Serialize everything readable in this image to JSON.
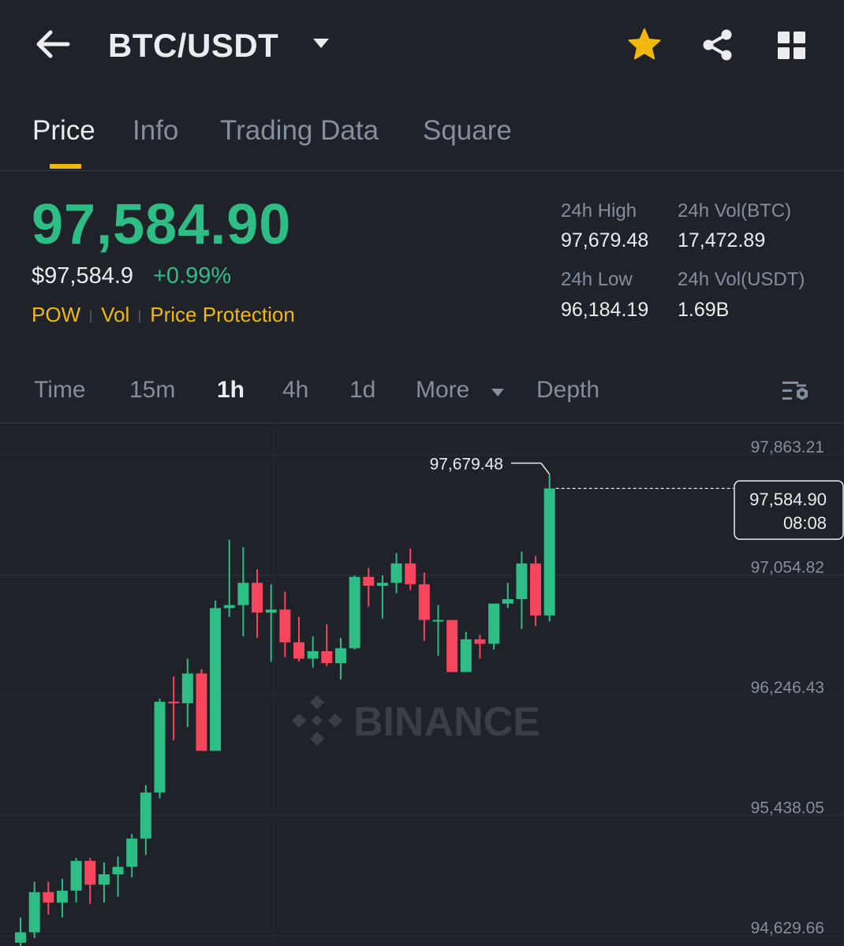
{
  "header": {
    "pair": "BTC/USDT",
    "icons": [
      "back-arrow-icon",
      "dropdown-caret-icon",
      "star-icon",
      "share-icon",
      "grid-icon"
    ],
    "favorite_color": "#f0b90b"
  },
  "tabs": [
    {
      "label": "Price",
      "active": true
    },
    {
      "label": "Info",
      "active": false
    },
    {
      "label": "Trading Data",
      "active": false
    },
    {
      "label": "Square",
      "active": false
    }
  ],
  "ticker": {
    "last_price": "97,584.90",
    "usd_price": "$97,584.9",
    "change": "+0.99%",
    "tags": [
      "POW",
      "Vol",
      "Price Protection"
    ],
    "high_label": "24h High",
    "high_value": "97,679.48",
    "vol_btc_label": "24h Vol(BTC)",
    "vol_btc_value": "17,472.89",
    "low_label": "24h Low",
    "low_value": "96,184.19",
    "vol_usdt_label": "24h Vol(USDT)",
    "vol_usdt_value": "1.69B"
  },
  "intervals": {
    "items": [
      "Time",
      "15m",
      "1h",
      "4h",
      "1d",
      "More",
      "Depth"
    ],
    "active": "1h"
  },
  "colors": {
    "up": "#2ebd85",
    "down": "#f6465d",
    "accent": "#f0b90b",
    "background": "#1f2229",
    "muted_text": "#848e9c"
  },
  "chart_data": {
    "type": "candlestick",
    "interval": "1h",
    "y_ticks": [
      "97,863.21",
      "97,054.82",
      "96,246.43",
      "95,438.05",
      "94,629.66"
    ],
    "ylim": [
      94629.66,
      97863.21
    ],
    "watermark": "BINANCE",
    "high_marker": "97,679.48",
    "current_price": "97,584.90",
    "countdown": "08:08",
    "candles": [
      {
        "o": 94530,
        "h": 94700,
        "l": 94410,
        "c": 94600
      },
      {
        "o": 94600,
        "h": 94940,
        "l": 94560,
        "c": 94870
      },
      {
        "o": 94870,
        "h": 94940,
        "l": 94720,
        "c": 94800
      },
      {
        "o": 94800,
        "h": 94960,
        "l": 94700,
        "c": 94880
      },
      {
        "o": 94880,
        "h": 95100,
        "l": 94800,
        "c": 95080
      },
      {
        "o": 95080,
        "h": 95100,
        "l": 94790,
        "c": 94920
      },
      {
        "o": 94920,
        "h": 95070,
        "l": 94800,
        "c": 94990
      },
      {
        "o": 94990,
        "h": 95110,
        "l": 94840,
        "c": 95040
      },
      {
        "o": 95040,
        "h": 95260,
        "l": 94970,
        "c": 95230
      },
      {
        "o": 95230,
        "h": 95590,
        "l": 95120,
        "c": 95540
      },
      {
        "o": 95540,
        "h": 96170,
        "l": 95500,
        "c": 96150
      },
      {
        "o": 96150,
        "h": 96320,
        "l": 95890,
        "c": 96140
      },
      {
        "o": 96140,
        "h": 96440,
        "l": 95980,
        "c": 96340
      },
      {
        "o": 96340,
        "h": 96370,
        "l": 95820,
        "c": 95820
      },
      {
        "o": 95820,
        "h": 96830,
        "l": 95820,
        "c": 96780
      },
      {
        "o": 96780,
        "h": 97240,
        "l": 96720,
        "c": 96800
      },
      {
        "o": 96800,
        "h": 97190,
        "l": 96590,
        "c": 96950
      },
      {
        "o": 96950,
        "h": 97040,
        "l": 96580,
        "c": 96750
      },
      {
        "o": 96750,
        "h": 96940,
        "l": 96420,
        "c": 96770
      },
      {
        "o": 96770,
        "h": 96890,
        "l": 96450,
        "c": 96550
      },
      {
        "o": 96550,
        "h": 96720,
        "l": 96420,
        "c": 96440
      },
      {
        "o": 96440,
        "h": 96590,
        "l": 96380,
        "c": 96490
      },
      {
        "o": 96490,
        "h": 96670,
        "l": 96390,
        "c": 96410
      },
      {
        "o": 96410,
        "h": 96580,
        "l": 96300,
        "c": 96510
      },
      {
        "o": 96510,
        "h": 97000,
        "l": 96500,
        "c": 96990
      },
      {
        "o": 96990,
        "h": 97050,
        "l": 96790,
        "c": 96930
      },
      {
        "o": 96930,
        "h": 97000,
        "l": 96710,
        "c": 96950
      },
      {
        "o": 96950,
        "h": 97150,
        "l": 96880,
        "c": 97080
      },
      {
        "o": 97080,
        "h": 97180,
        "l": 96900,
        "c": 96940
      },
      {
        "o": 96940,
        "h": 97020,
        "l": 96560,
        "c": 96700
      },
      {
        "o": 96700,
        "h": 96800,
        "l": 96460,
        "c": 96700
      },
      {
        "o": 96700,
        "h": 96700,
        "l": 96350,
        "c": 96350
      },
      {
        "o": 96350,
        "h": 96620,
        "l": 96350,
        "c": 96570
      },
      {
        "o": 96570,
        "h": 96600,
        "l": 96440,
        "c": 96540
      },
      {
        "o": 96540,
        "h": 96810,
        "l": 96500,
        "c": 96810
      },
      {
        "o": 96810,
        "h": 96950,
        "l": 96780,
        "c": 96840
      },
      {
        "o": 96840,
        "h": 97160,
        "l": 96640,
        "c": 97080
      },
      {
        "o": 97080,
        "h": 97130,
        "l": 96660,
        "c": 96730
      },
      {
        "o": 96730,
        "h": 97680,
        "l": 96690,
        "c": 97584.9
      }
    ]
  }
}
